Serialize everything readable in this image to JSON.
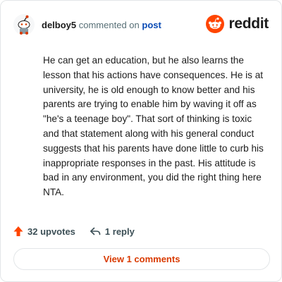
{
  "comment": {
    "username": "delboy5",
    "action_text": "commented on",
    "link_text": "post",
    "text": "He can get an education, but he also learns the lesson that his actions have consequences. He is at university, he is old enough to know better and his parents are trying to enable him by waving it off as \"he's a teenage boy\". That sort of thinking is toxic and that statement along with his general conduct suggests that his parents have done little to curb his inappropriate responses in the past. His attitude is bad in any environment, you did the right thing here NTA."
  },
  "brand": {
    "name": "reddit",
    "icon": "reddit-logo-icon",
    "color": "#ff4500"
  },
  "actions": {
    "upvotes": "32 upvotes",
    "replies": "1 reply",
    "upvote_icon": "upvote-arrow-icon",
    "reply_icon": "reply-arrow-icon"
  },
  "view_button": {
    "label": "View 1 comments"
  },
  "colors": {
    "accent": "#d93a00",
    "upvote": "#ff4500",
    "link": "#0a4bb5"
  }
}
